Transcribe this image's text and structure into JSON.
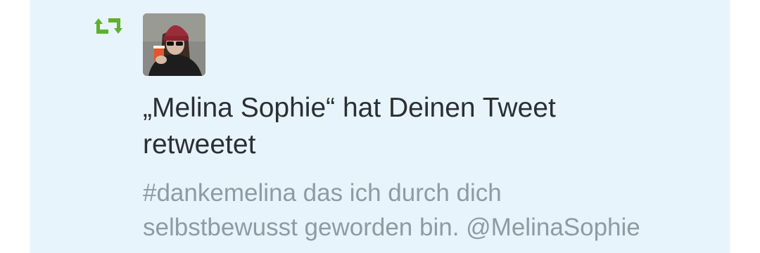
{
  "notification": {
    "type_icon": "retweet-icon",
    "type_icon_color": "#5db12b",
    "avatar_icon": "user-avatar-photo",
    "headline_line1": "„Melina Sophie“ hat Deinen Tweet",
    "headline_line2": "retweetet",
    "tweet_line1": "#dankemelina das ich durch dich",
    "tweet_line2": "selbstbewusst geworden bin. @MelinaSophie"
  },
  "colors": {
    "card_background": "#e8f4fb",
    "headline_text": "#2a2f33",
    "tweet_text": "#8f9ba3"
  }
}
